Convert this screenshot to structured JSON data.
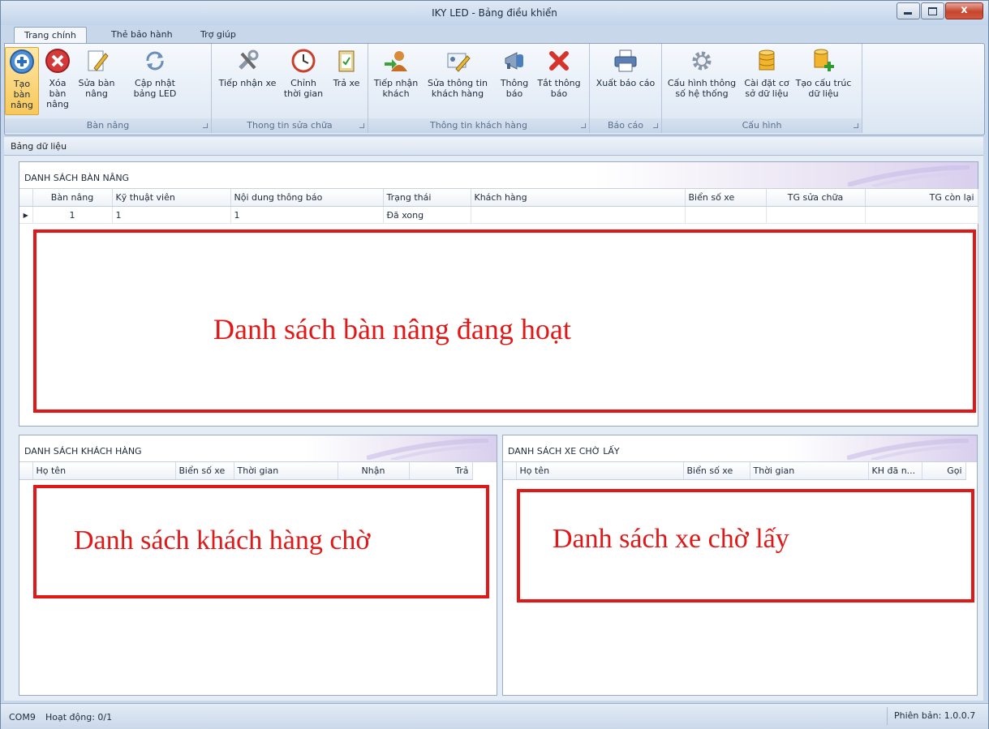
{
  "window": {
    "title": "IKY LED - Bảng điều khiển",
    "close_glyph": "x"
  },
  "tabs": [
    {
      "label": "Trang chính"
    },
    {
      "label": "Thẻ bảo hành"
    },
    {
      "label": "Trợ giúp"
    }
  ],
  "ribbon": {
    "groups": [
      {
        "label": "Bàn nâng"
      },
      {
        "label": "Thong tin sửa chữa"
      },
      {
        "label": "Thông tin khách hàng"
      },
      {
        "label": "Báo cáo"
      },
      {
        "label": "Cấu hình"
      }
    ],
    "buttons": {
      "tao_ban_nang": [
        "Tạo bàn",
        "nâng"
      ],
      "xoa_ban_nang": [
        "Xóa bàn",
        "nâng"
      ],
      "sua_ban_nang": [
        "Sửa bàn",
        "nâng"
      ],
      "cap_nhat_led": [
        "Cập nhật",
        "bảng LED"
      ],
      "tiep_nhan_xe": [
        "Tiếp nhận xe",
        ""
      ],
      "chinh_thoi_gian": [
        "Chỉnh",
        "thời gian"
      ],
      "tra_xe": [
        "Trả xe",
        ""
      ],
      "tiep_nhan_khach": [
        "Tiếp nhận",
        "khách"
      ],
      "sua_thong_tin_kh": [
        "Sửa thông tin",
        "khách hàng"
      ],
      "thong_bao": [
        "Thông",
        "báo"
      ],
      "tat_thong_bao": [
        "Tắt thông",
        "báo"
      ],
      "xuat_bao_cao": [
        "Xuất báo cáo",
        ""
      ],
      "cau_hinh_thong_so": [
        "Cấu hình thông",
        "số hệ thống"
      ],
      "cai_dat_csdl": [
        "Cài đặt cơ",
        "sở dữ liệu"
      ],
      "tao_cau_truc": [
        "Tạo cấu trúc",
        "dữ liệu"
      ]
    }
  },
  "subbar": {
    "label": "Bảng dữ liệu"
  },
  "lift_panel": {
    "title": "DANH SÁCH BÀN NÂNG",
    "columns": [
      "Bàn nâng",
      "Kỹ thuật viên",
      "Nội dung thông báo",
      "Trạng thái",
      "Khách hàng",
      "Biển số xe",
      "TG sửa chữa",
      "TG còn lại"
    ],
    "rows": [
      [
        "1",
        "1",
        "1",
        "Đã xong",
        "",
        "",
        "",
        ""
      ]
    ],
    "annotation": "Danh sách bàn nâng đang hoạt"
  },
  "customer_panel": {
    "title": "DANH SÁCH KHÁCH HÀNG",
    "columns": [
      "Họ tên",
      "Biển số xe",
      "Thời gian",
      "Nhận",
      "Trả"
    ],
    "annotation": "Danh sách khách hàng chờ"
  },
  "pickup_panel": {
    "title": "DANH SÁCH XE CHỜ LẤY",
    "columns": [
      "Họ tên",
      "Biển số xe",
      "Thời gian",
      "KH đã n...",
      "Gọi"
    ],
    "annotation": "Danh sách xe chờ lấy"
  },
  "status": {
    "port": "COM9",
    "activity": "Hoạt động: 0/1",
    "version": "Phiên bản: 1.0.0.7"
  },
  "colors": {
    "annotation_red": "#e01818",
    "ribbon_bg": "#dbe6f3"
  }
}
